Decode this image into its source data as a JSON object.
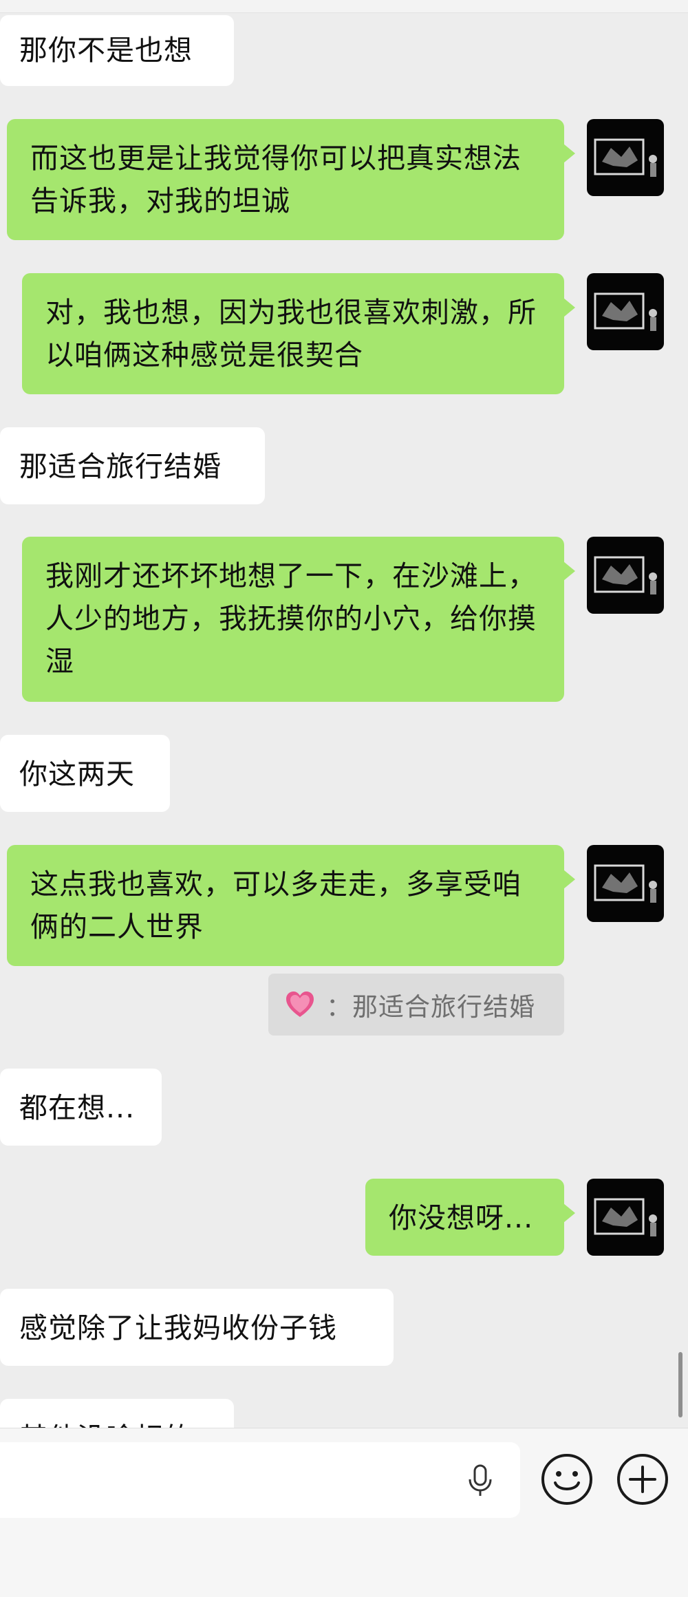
{
  "messages": [
    {
      "side": "left",
      "text": "那你不是也想"
    },
    {
      "side": "right",
      "text": "而这也更是让我觉得你可以把真实想法告诉我，对我的坦诚"
    },
    {
      "side": "right",
      "text": "对，我也想，因为我也很喜欢刺激，所以咱俩这种感觉是很契合"
    },
    {
      "side": "left",
      "text": "那适合旅行结婚"
    },
    {
      "side": "right",
      "text": "我刚才还坏坏地想了一下，在沙滩上，人少的地方，我抚摸你的小穴，给你摸湿"
    },
    {
      "side": "left",
      "text": "你这两天"
    },
    {
      "side": "right",
      "text": "这点我也喜欢，可以多走走，多享受咱俩的二人世界"
    },
    {
      "side": "left",
      "text": "都在想..."
    },
    {
      "side": "right",
      "text": "你没想呀..."
    },
    {
      "side": "left",
      "text": "感觉除了让我妈收份子钱"
    },
    {
      "side": "left",
      "text": "其他没啥相的"
    }
  ],
  "quote": {
    "icon": "heart-icon",
    "text": "：那适合旅行结婚"
  },
  "input": {
    "value": "",
    "mic_icon": "mic-icon",
    "emoji_icon": "emoji-icon",
    "plus_icon": "plus-icon"
  },
  "colors": {
    "background": "#ededed",
    "bubble_self": "#a5e66e",
    "bubble_other": "#ffffff",
    "quote_bg": "#dcdcdc"
  }
}
